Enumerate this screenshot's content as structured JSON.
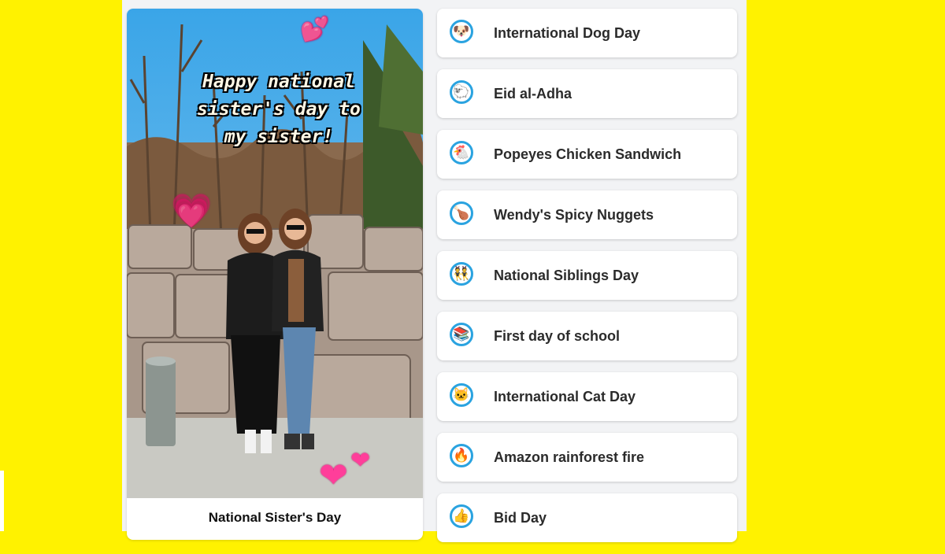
{
  "story": {
    "overlay_text": "Happy national\nsister's day to\nmy sister!",
    "caption": "National Sister's Day"
  },
  "lenses": [
    {
      "label": "International Dog Day",
      "icon": "dog-face-icon",
      "emoji": "🐶"
    },
    {
      "label": "Eid al-Adha",
      "icon": "sheep-icon",
      "emoji": "🐑"
    },
    {
      "label": "Popeyes Chicken Sandwich",
      "icon": "chicken-icon",
      "emoji": "🐔"
    },
    {
      "label": "Wendy's Spicy Nuggets",
      "icon": "poultry-leg-icon",
      "emoji": "🍗"
    },
    {
      "label": "National Siblings Day",
      "icon": "siblings-icon",
      "emoji": "👯"
    },
    {
      "label": "First day of school",
      "icon": "books-icon",
      "emoji": "📚"
    },
    {
      "label": "International Cat Day",
      "icon": "cat-face-icon",
      "emoji": "🐱"
    },
    {
      "label": "Amazon rainforest fire",
      "icon": "fire-icon",
      "emoji": "🔥"
    },
    {
      "label": "Bid Day",
      "icon": "thumbs-up-icon",
      "emoji": "👍"
    }
  ],
  "colors": {
    "background": "#FFF200",
    "icon_ring": "#2aa3e0",
    "heart": "#ff3e9a"
  }
}
